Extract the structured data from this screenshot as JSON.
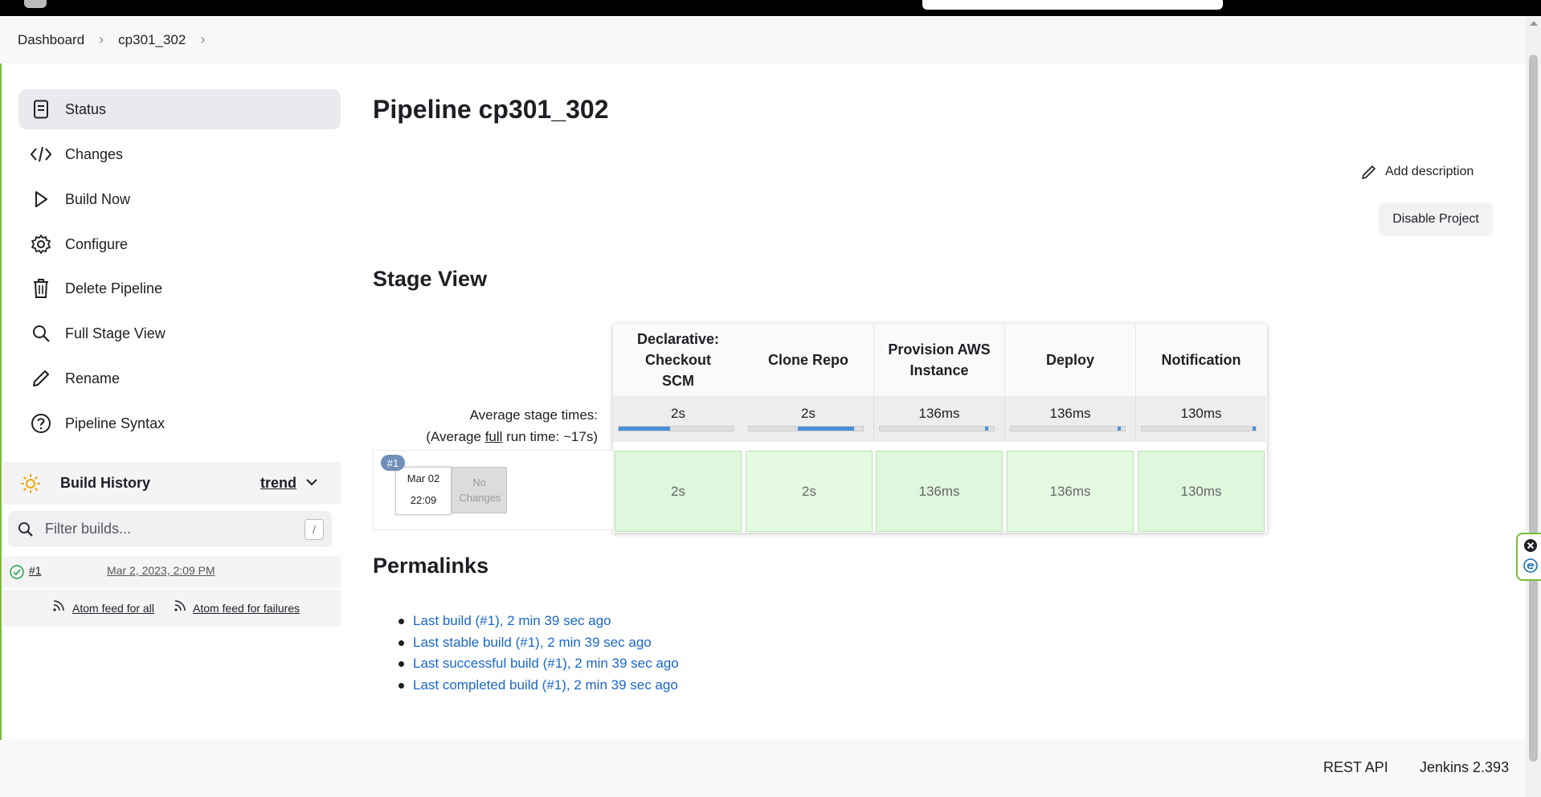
{
  "breadcrumbs": [
    "Dashboard",
    "cp301_302"
  ],
  "sidebar": {
    "tasks": [
      {
        "label": "Status",
        "icon": "document-icon",
        "active": true
      },
      {
        "label": "Changes",
        "icon": "code-icon"
      },
      {
        "label": "Build Now",
        "icon": "play-icon"
      },
      {
        "label": "Configure",
        "icon": "gear-icon"
      },
      {
        "label": "Delete Pipeline",
        "icon": "trash-icon"
      },
      {
        "label": "Full Stage View",
        "icon": "search-icon"
      },
      {
        "label": "Rename",
        "icon": "pencil-icon"
      },
      {
        "label": "Pipeline Syntax",
        "icon": "help-icon"
      }
    ],
    "build_history": {
      "title": "Build History",
      "trend_label": "trend",
      "filter_placeholder": "Filter builds...",
      "filter_shortcut": "/",
      "builds": [
        {
          "number": "#1",
          "date": "Mar 2, 2023, 2:09 PM",
          "status": "success"
        }
      ],
      "atom_all": "Atom feed for all",
      "atom_failures": "Atom feed for failures"
    }
  },
  "main": {
    "title": "Pipeline cp301_302",
    "add_description": "Add description",
    "disable_project": "Disable Project",
    "stage_view_title": "Stage View",
    "avg_stage_times_label": "Average stage times:",
    "avg_full_run_prefix": "(Average ",
    "avg_full_run_full": "full",
    "avg_full_run_suffix": " run time: ~17s)",
    "stages": [
      {
        "name": "Declarative: Checkout SCM",
        "avg": "2s",
        "result": "2s",
        "bar_start": 0.0,
        "bar_fill": 0.45
      },
      {
        "name": "Clone Repo",
        "avg": "2s",
        "result": "2s",
        "bar_start": 0.43,
        "bar_fill": 0.49
      },
      {
        "name": "Provision AWS Instance",
        "avg": "136ms",
        "result": "136ms",
        "bar_start": 0.92,
        "bar_fill": 0.03
      },
      {
        "name": "Deploy",
        "avg": "136ms",
        "result": "136ms",
        "bar_start": 0.94,
        "bar_fill": 0.03
      },
      {
        "name": "Notification",
        "avg": "130ms",
        "result": "130ms",
        "bar_start": 0.97,
        "bar_fill": 0.03
      }
    ],
    "run": {
      "badge": "#1",
      "date": "Mar 02",
      "time": "22:09",
      "no_changes": "No Changes"
    },
    "permalinks_title": "Permalinks",
    "permalinks": [
      "Last build (#1), 2 min 39 sec ago",
      "Last stable build (#1), 2 min 39 sec ago",
      "Last successful build (#1), 2 min 39 sec ago",
      "Last completed build (#1), 2 min 39 sec ago"
    ]
  },
  "footer": {
    "rest_api": "REST API",
    "version": "Jenkins 2.393"
  },
  "colors": {
    "accent": "#1966c9",
    "success_cell": "#dff7dc",
    "success_icon": "#1ea446",
    "sun_icon": "#f2a900"
  }
}
